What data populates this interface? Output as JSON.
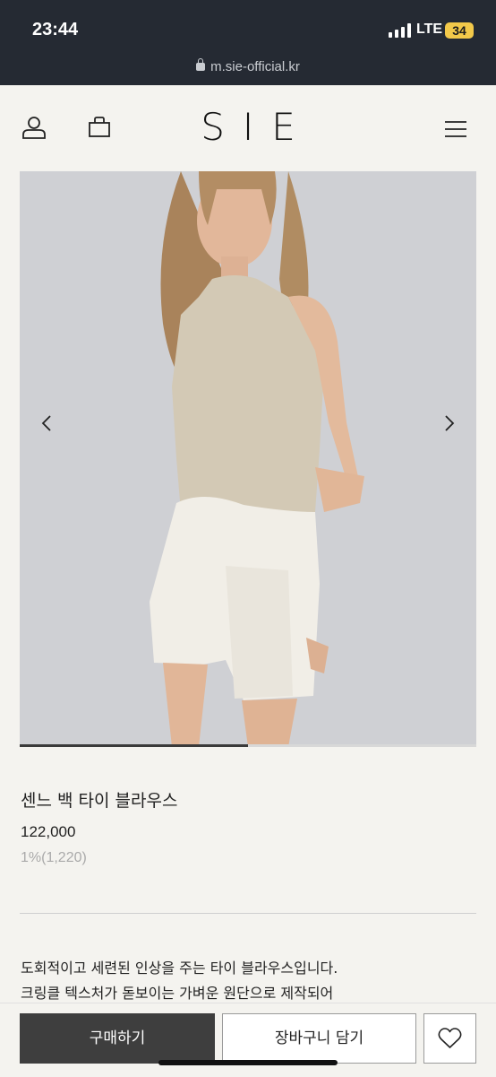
{
  "status_bar": {
    "time": "23:44",
    "network": "LTE",
    "battery": "34"
  },
  "browser": {
    "url": "m.sie-official.kr"
  },
  "header": {
    "logo": "SIE",
    "icons": [
      "user-icon",
      "shopping-bag-icon",
      "menu-icon"
    ]
  },
  "gallery": {
    "progress": 0.5,
    "prev_icon": "chevron-left-icon",
    "next_icon": "chevron-right-icon"
  },
  "product": {
    "name": "센느 백 타이 블라우스",
    "price": "122,000",
    "points": "1%(1,220)",
    "description": [
      "도회적이고 세련된 인상을 주는 타이 블라우스입니다.",
      "크링클 텍스처가 돋보이는 가벼운 원단으로 제작되어"
    ]
  },
  "actions": {
    "buy_label": "구매하기",
    "cart_label": "장바구니 담기",
    "wish_icon": "heart-icon"
  },
  "colors": {
    "status_bg": "#252a33",
    "page_bg": "#f4f3ef",
    "buy_bg": "#3e3e3e"
  }
}
